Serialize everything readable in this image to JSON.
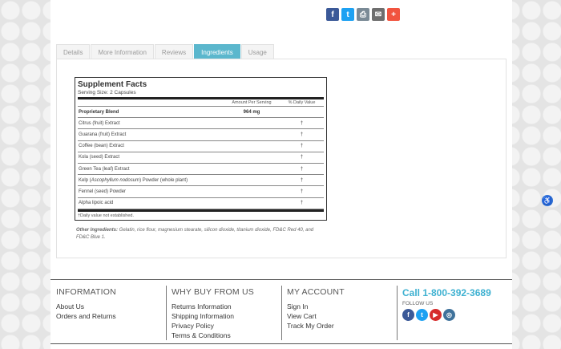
{
  "share": {
    "buttons": [
      {
        "name": "facebook",
        "glyph": "f",
        "color": "#3b5998"
      },
      {
        "name": "twitter",
        "glyph": "t",
        "color": "#1da1f2"
      },
      {
        "name": "print",
        "glyph": "⎙",
        "color": "#7a8a96"
      },
      {
        "name": "email",
        "glyph": "✉",
        "color": "#6e6e6e"
      },
      {
        "name": "more",
        "glyph": "+",
        "color": "#f1543f"
      }
    ]
  },
  "tabs": [
    {
      "label": "Details",
      "active": false
    },
    {
      "label": "More Information",
      "active": false
    },
    {
      "label": "Reviews",
      "active": false
    },
    {
      "label": "Ingredients",
      "active": true
    },
    {
      "label": "Usage",
      "active": false
    }
  ],
  "facts": {
    "title": "Supplement Facts",
    "serving": "Serving Size: 2 Capsules",
    "col_amount": "Amount Per Serving",
    "col_dv": "% Daily Value",
    "rows": [
      {
        "name": "Proprietary Blend",
        "amount": "964 mg",
        "dv": ""
      },
      {
        "name": "Citrus (fruit) Extract",
        "amount": "",
        "dv": "†"
      },
      {
        "name": "Guarana (fruit) Extract",
        "amount": "",
        "dv": "†"
      },
      {
        "name": "Coffee (bean) Extract",
        "amount": "",
        "dv": "†"
      },
      {
        "name": "Kola (seed) Extract",
        "amount": "",
        "dv": "†"
      },
      {
        "name": "Green Tea (leaf) Extract",
        "amount": "",
        "dv": "†"
      },
      {
        "name": "Kelp (Ascophyllum nodosum) Powder (whole plant)",
        "amount": "",
        "dv": "†"
      },
      {
        "name": "Fennel (seed) Powder",
        "amount": "",
        "dv": "†"
      },
      {
        "name": "Alpha lipoic acid",
        "amount": "",
        "dv": "†"
      }
    ],
    "note": "†Daily value not established."
  },
  "other_ingredients": {
    "label": "Other Ingredients:",
    "text": " Gelatin, rice flour, magnesium stearate, silicon dioxide, titanium dioxide, FD&C Red 40, and FD&C Blue 1."
  },
  "footer": {
    "information": {
      "heading": "INFORMATION",
      "links": [
        "About Us",
        "Orders and Returns"
      ]
    },
    "why": {
      "heading": "WHY BUY FROM US",
      "links": [
        "Returns Information",
        "Shipping Information",
        "Privacy Policy",
        "Terms & Conditions"
      ]
    },
    "account": {
      "heading": "MY ACCOUNT",
      "links": [
        "Sign In",
        "View Cart",
        "Track My Order"
      ]
    },
    "contact": {
      "phone": "Call 1-800-392-3689",
      "follow": "FOLLOW US",
      "social": [
        {
          "name": "facebook",
          "glyph": "f",
          "color": "#3b5998"
        },
        {
          "name": "twitter",
          "glyph": "t",
          "color": "#1da1f2"
        },
        {
          "name": "youtube",
          "glyph": "▶",
          "color": "#d62b2b"
        },
        {
          "name": "instagram",
          "glyph": "◎",
          "color": "#3f729b"
        }
      ]
    }
  },
  "accessibility": {
    "glyph": "♿"
  }
}
